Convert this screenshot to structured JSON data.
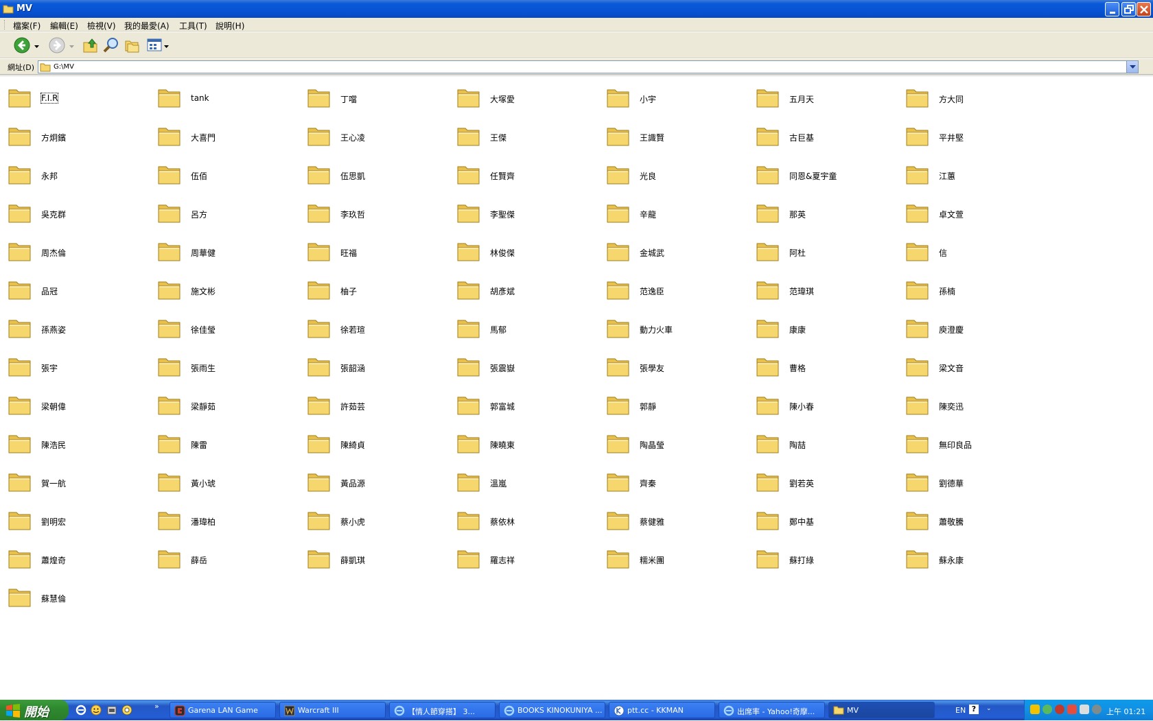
{
  "window": {
    "title": "MV",
    "menu": [
      "檔案(F)",
      "編輯(E)",
      "檢視(V)",
      "我的最愛(A)",
      "工具(T)",
      "說明(H)"
    ]
  },
  "address": {
    "label": "網址(D)",
    "value": "G:\\MV"
  },
  "folders": [
    "F.I.R",
    "tank",
    "丁噹",
    "大塚愛",
    "小宇",
    "五月天",
    "方大同",
    "方炯鑌",
    "大喜門",
    "王心凌",
    "王傑",
    "王識賢",
    "古巨基",
    "平井堅",
    "永邦",
    "伍佰",
    "伍思凱",
    "任賢齊",
    "光良",
    "同恩&夏宇童",
    "江蕙",
    "吳克群",
    "呂方",
    "李玖哲",
    "李聖傑",
    "辛龍",
    "那英",
    "卓文萱",
    "周杰倫",
    "周華健",
    "旺福",
    "林俊傑",
    "金城武",
    "阿杜",
    "信",
    "品冠",
    "施文彬",
    "柚子",
    "胡彥斌",
    "范逸臣",
    "范瑋琪",
    "孫楠",
    "孫燕姿",
    "徐佳瑩",
    "徐若瑄",
    "馬郁",
    "動力火車",
    "康康",
    "庾澄慶",
    "張宇",
    "張雨生",
    "張韶涵",
    "張震嶽",
    "張學友",
    "曹格",
    "梁文音",
    "梁朝偉",
    "梁靜茹",
    "許茹芸",
    "郭富城",
    "郭靜",
    "陳小春",
    "陳奕迅",
    "陳浩民",
    "陳雷",
    "陳綺貞",
    "陳曉東",
    "陶晶瑩",
    "陶喆",
    "無印良品",
    "賀一航",
    "黃小琥",
    "黃品源",
    "溫嵐",
    "齊秦",
    "劉若英",
    "劉德華",
    "劉明宏",
    "潘瑋柏",
    "蔡小虎",
    "蔡依林",
    "蔡健雅",
    "鄭中基",
    "蕭敬騰",
    "蕭煌奇",
    "薛岳",
    "薛凱琪",
    "羅志祥",
    "糯米團",
    "蘇打綠",
    "蘇永康",
    "蘇慧倫"
  ],
  "taskbar": {
    "start_label": "開始",
    "tasks": [
      "Garena LAN Game",
      "Warcraft III",
      "【情人節穿搭】 3...",
      "BOOKS KINOKUNIYA ...",
      "ptt.cc - KKMAN",
      "出席率 - Yahoo!奇摩...",
      "MV"
    ],
    "language": "EN",
    "clock": "上午 01:21"
  },
  "colors": {
    "folder_body": "#f5d76e",
    "folder_tab": "#e8c04c",
    "titlebar": "#0551d2",
    "taskbar": "#245ed5",
    "start": "#2f8a2f"
  }
}
